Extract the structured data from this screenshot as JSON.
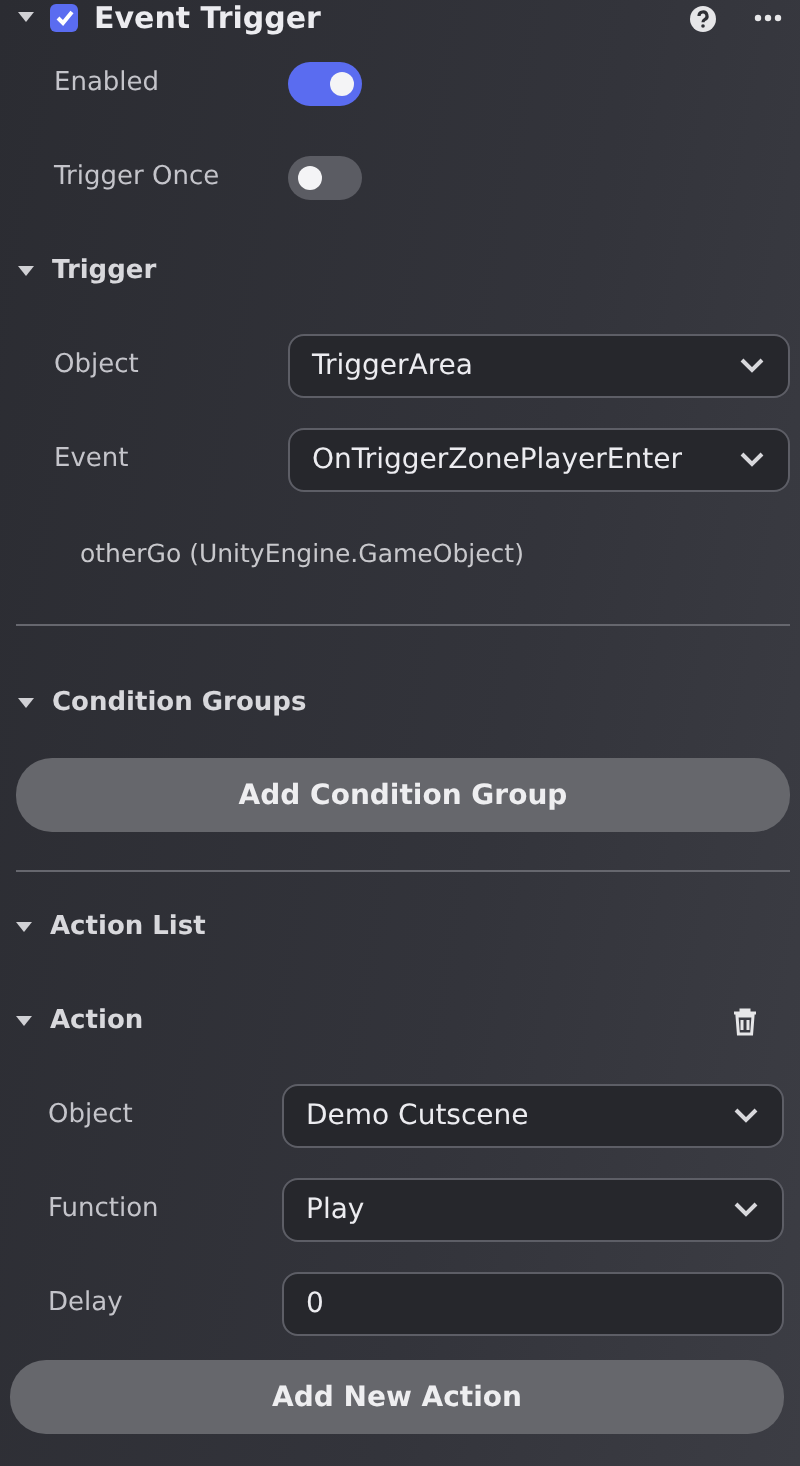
{
  "component": {
    "title": "Event Trigger",
    "checked": true,
    "expanded": true
  },
  "settings": [
    {
      "label": "Enabled",
      "on": true
    },
    {
      "label": "Trigger Once",
      "on": false
    }
  ],
  "trigger": {
    "title": "Trigger",
    "expanded": true,
    "fields": [
      {
        "label": "Object",
        "value": "TriggerArea"
      },
      {
        "label": "Event",
        "value": "OnTriggerZonePlayerEnter"
      }
    ],
    "parameter": "otherGo (UnityEngine.GameObject)"
  },
  "condition_groups": {
    "title": "Condition Groups",
    "expanded": true,
    "button": "Add Condition Group"
  },
  "action_list": {
    "title": "Action List",
    "expanded": true,
    "actions": [
      {
        "title": "Action",
        "expanded": true,
        "fields": [
          {
            "kind": "dropdown",
            "label": "Object",
            "value": "Demo Cutscene"
          },
          {
            "kind": "dropdown",
            "label": "Function",
            "value": "Play"
          },
          {
            "kind": "input",
            "label": "Delay",
            "value": "0"
          }
        ]
      }
    ],
    "button": "Add New Action"
  }
}
